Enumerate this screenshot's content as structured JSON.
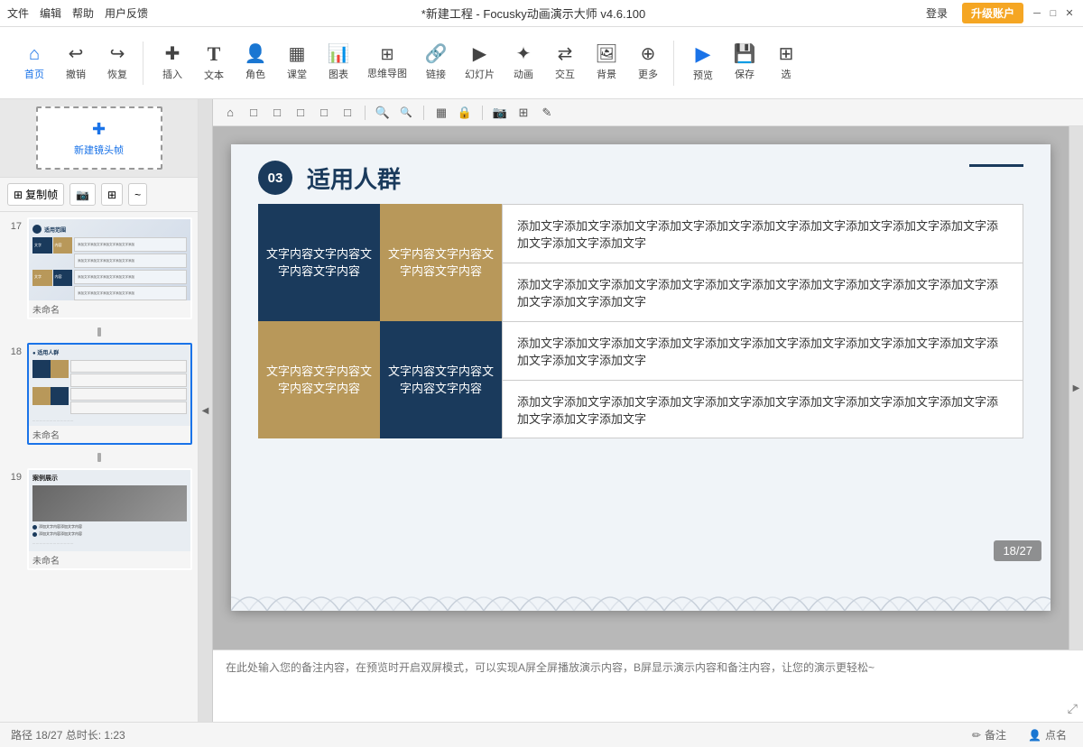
{
  "titlebar": {
    "menu_items": [
      "文件",
      "编辑",
      "帮助",
      "用户反馈"
    ],
    "title": "*新建工程 - Focusky动画演示大师 v4.6.100",
    "login": "登录",
    "upgrade": "升级账户",
    "win_min": "─",
    "win_max": "□",
    "win_close": "✕"
  },
  "toolbar": {
    "groups": [
      {
        "items": [
          {
            "icon": "⌂",
            "label": "首页",
            "active": true
          },
          {
            "icon": "↩",
            "label": "撤销"
          },
          {
            "icon": "↪",
            "label": "恢复"
          }
        ]
      },
      {
        "items": [
          {
            "icon": "✚",
            "label": "插入"
          },
          {
            "icon": "T",
            "label": "文本"
          },
          {
            "icon": "👤",
            "label": "角色"
          },
          {
            "icon": "▦",
            "label": "课堂"
          },
          {
            "icon": "📊",
            "label": "图表"
          },
          {
            "icon": "⊞",
            "label": "思维导图"
          },
          {
            "icon": "🔗",
            "label": "链接"
          },
          {
            "icon": "▶",
            "label": "幻灯片"
          },
          {
            "icon": "✦",
            "label": "动画"
          },
          {
            "icon": "⇄",
            "label": "交互"
          },
          {
            "icon": "🖼",
            "label": "背景"
          },
          {
            "icon": "⊕",
            "label": "更多"
          }
        ]
      },
      {
        "items": [
          {
            "icon": "▶",
            "label": "预览"
          },
          {
            "icon": "💾",
            "label": "保存"
          },
          {
            "icon": "⊞",
            "label": "选"
          }
        ]
      }
    ]
  },
  "sidebar": {
    "new_shot_label": "新建镜头帧",
    "tools": [
      "复制帧",
      "📷",
      "⊞",
      "~"
    ],
    "slides": [
      {
        "num": "17",
        "label": "未命名",
        "active": false
      },
      {
        "num": "18",
        "label": "未命名",
        "active": true
      },
      {
        "num": "19",
        "label": "未命名",
        "active": false
      }
    ]
  },
  "canvas_toolbar": {
    "buttons": [
      "⌂",
      "□",
      "□",
      "□",
      "□",
      "□",
      "🔍+",
      "🔍-",
      "▦",
      "🔒",
      "📷",
      "⊞",
      "✎"
    ]
  },
  "slide": {
    "badge_num": "03",
    "title": "适用人群",
    "grid_cells": [
      {
        "text": "文字内容文字内容文字内容文字内容",
        "style": "dark"
      },
      {
        "text": "文字内容文字内容文字内容文字内容",
        "style": "tan"
      },
      {
        "text": "文字内容文字内容文字内容文字内容",
        "style": "tan"
      },
      {
        "text": "文字内容文字内容文字内容文字内容",
        "style": "dark"
      }
    ],
    "right_items": [
      "添加文字添加文字添加文字添加文字添加文字添加文字添加文字添加文字添加文字添加文字添加文字添加文字添加文字",
      "添加文字添加文字添加文字添加文字添加文字添加文字添加文字添加文字添加文字添加文字添加文字添加文字添加文字",
      "添加文字添加文字添加文字添加文字添加文字添加文字添加文字添加文字添加文字添加文字添加文字添加文字添加文字",
      "添加文字添加文字添加文字添加文字添加文字添加文字添加文字添加文字添加文字添加文字添加文字添加文字添加文字"
    ]
  },
  "page_indicator": "18/27",
  "notes": {
    "placeholder": "在此处输入您的备注内容，在预览时开启双屏模式，可以实现A屏全屏播放演示内容，B屏显示演示内容和备注内容，让您的演示更轻松~"
  },
  "statusbar": {
    "path": "路径 18/27  总时长: 1:23",
    "annotation": "备注",
    "dot_name": "点名"
  },
  "colors": {
    "dark_blue": "#1a3a5c",
    "tan": "#b8985a",
    "accent": "#1a73e8"
  }
}
